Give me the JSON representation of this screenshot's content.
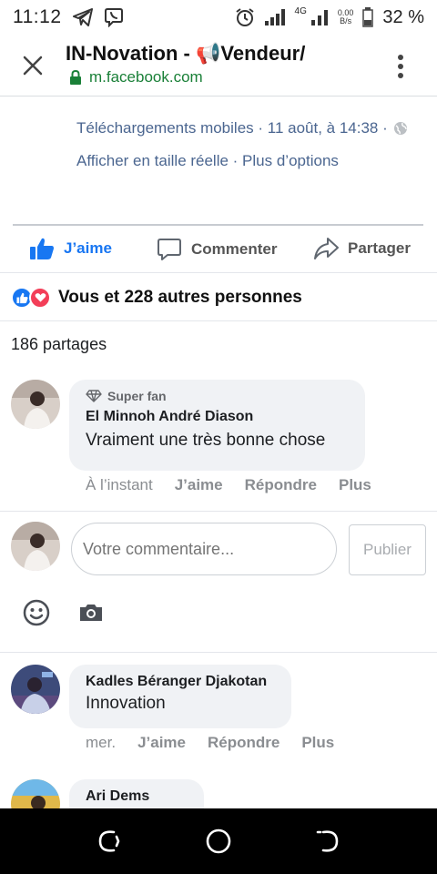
{
  "status_bar": {
    "time": "11:12",
    "network": "4G",
    "speed_value": "0.00",
    "speed_unit": "B/s",
    "battery": "32 %"
  },
  "browser": {
    "page_title": "IN-Novation - 📢Vendeur/",
    "url": "m.facebook.com"
  },
  "photo_meta": {
    "source_line": "Téléchargements mobiles · 11 août, à 14:38 ·",
    "options_line": "Afficher en taille réelle · Plus d’options"
  },
  "actions": {
    "like": "J’aime",
    "comment": "Commenter",
    "share": "Partager"
  },
  "reactions": {
    "summary": "Vous et 228 autres personnes",
    "shares": "186 partages"
  },
  "comments": [
    {
      "badge": "Super fan",
      "author": "El Minnoh André Diason",
      "text": "Vraiment une très bonne chose",
      "time": "À l’instant",
      "like": "J’aime",
      "reply": "Répondre",
      "more": "Plus"
    },
    {
      "author": "Kadles Béranger Djakotan",
      "text": "Innovation",
      "time": "mer.",
      "like": "J’aime",
      "reply": "Répondre",
      "more": "Plus"
    },
    {
      "author": "Ari Dems"
    }
  ],
  "composer": {
    "placeholder": "Votre commentaire...",
    "publish": "Publier"
  },
  "colors": {
    "accent": "#1877f2",
    "love": "#f33e58",
    "secure": "#1a8038"
  }
}
